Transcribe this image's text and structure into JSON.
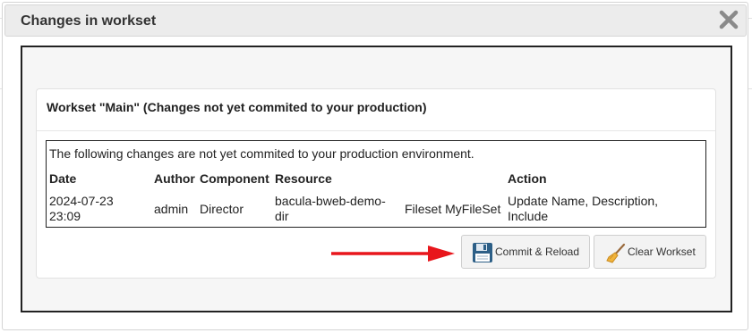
{
  "dialog": {
    "title": "Changes in workset"
  },
  "panel": {
    "title": "Workset \"Main\" (Changes not yet commited to your production)"
  },
  "changes": {
    "intro": "The following changes are not yet commited to your production environment.",
    "columns": [
      "Date",
      "Author",
      "Component",
      "Resource",
      "Action"
    ],
    "rows": [
      {
        "date_line1": "2024-07-23",
        "date_line2": "23:09",
        "author": "admin",
        "component": "Director",
        "resource_line1": "bacula-bweb-demo-",
        "resource_line2": "dir",
        "resource_type": "Fileset MyFileSet",
        "action_line1": "Update Name, Description,",
        "action_line2": "Include"
      }
    ]
  },
  "buttons": {
    "commit_label": "Commit & Reload",
    "clear_label": "Clear Workset"
  },
  "icons": {
    "close": "close-icon",
    "commit": "floppy-disk-icon",
    "clear": "broom-icon",
    "pointer": "red-arrow-icon"
  },
  "colors": {
    "arrow": "#e8161c",
    "floppy": "#2d5f87"
  }
}
